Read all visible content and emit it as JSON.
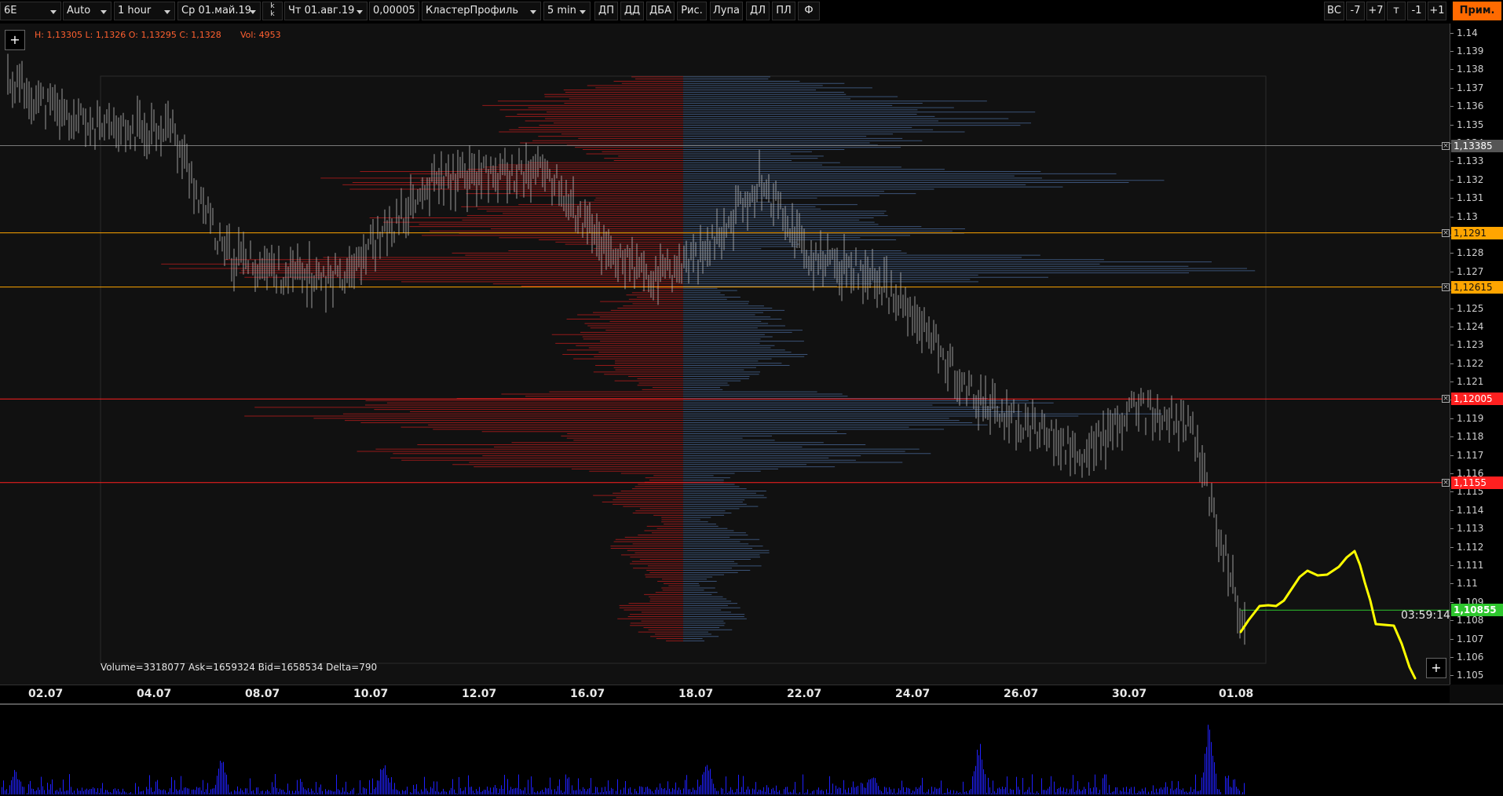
{
  "toolbar": {
    "symbol": "6E",
    "scale_mode": "Auto",
    "timeframe": "1 hour",
    "date_from": "Ср 01.май.19",
    "step_back_top": "k",
    "step_back_bottom": "k",
    "date_to": "Чт 01.авг.19",
    "tick_size": "0,00005",
    "chart_type": "КластерПрофиль",
    "cluster_timeframe": "5 min",
    "buttons": [
      "ДП",
      "ДД",
      "ДБА",
      "Рис.",
      "Лупа",
      "ДЛ",
      "ПЛ",
      "Ф"
    ],
    "right_buttons": [
      "ВС",
      "-7",
      "+7",
      "т",
      "-1",
      "+1"
    ],
    "apply_label": "Прим."
  },
  "info_bar": {
    "ohlc": "H: 1,13305 L: 1,1326 O: 1,13295 C: 1,1328",
    "volume": "Vol: 4953"
  },
  "plus_label": "+",
  "price_axis": {
    "ticks": [
      "1.14",
      "1.139",
      "1.138",
      "1.137",
      "1.136",
      "1.135",
      "1.134",
      "1.133",
      "1.132",
      "1.131",
      "1.13",
      "1.129",
      "1.128",
      "1.127",
      "1.126",
      "1.125",
      "1.124",
      "1.123",
      "1.122",
      "1.121",
      "1.12",
      "1.119",
      "1.118",
      "1.117",
      "1.116",
      "1.115",
      "1.114",
      "1.113",
      "1.112",
      "1.111",
      "1.11",
      "1.109",
      "1.108",
      "1.107",
      "1.106",
      "1.105"
    ],
    "levels": [
      {
        "label": "1,13385",
        "price": 1.13385,
        "style": "gray"
      },
      {
        "label": "1,1291",
        "price": 1.1291,
        "style": "orange"
      },
      {
        "label": "1,12615",
        "price": 1.12615,
        "style": "orange"
      },
      {
        "label": "1,12005",
        "price": 1.12005,
        "style": "red"
      },
      {
        "label": "1,1155",
        "price": 1.1155,
        "style": "red"
      },
      {
        "label": "1,10855",
        "price": 1.10855,
        "style": "green"
      }
    ]
  },
  "countdown": "03:59:14",
  "profile_stats": "Volume=3318077  Ask=1659324  Bid=1658534  Delta=790",
  "date_axis": [
    "02.07",
    "04.07",
    "08.07",
    "10.07",
    "12.07",
    "16.07",
    "18.07",
    "22.07",
    "24.07",
    "26.07",
    "30.07",
    "01.08"
  ],
  "colors": {
    "ask_profile": "#ff2020",
    "bid_profile": "#4a6a9a",
    "price_bars": "#bdbdbd",
    "volume_bars": "#2020ff",
    "forecast_line": "#ffff00",
    "level_orange": "#ffa500",
    "level_red": "#ff2020",
    "level_gray": "#7a7a7a",
    "level_green": "#2ec62e"
  },
  "chart_data": {
    "type": "line",
    "x": [
      "01.07",
      "02.07",
      "03.07",
      "04.07",
      "05.07",
      "08.07",
      "09.07",
      "10.07",
      "11.07",
      "12.07",
      "15.07",
      "16.07",
      "17.07",
      "18.07",
      "19.07",
      "22.07",
      "23.07",
      "24.07",
      "25.07",
      "26.07",
      "29.07",
      "30.07",
      "31.07",
      "01.08"
    ],
    "series": [
      {
        "values": [
          1.1375,
          1.1355,
          1.1345,
          1.135,
          1.128,
          1.127,
          1.1265,
          1.129,
          1.132,
          1.1322,
          1.1325,
          1.1285,
          1.1265,
          1.128,
          1.132,
          1.1275,
          1.127,
          1.124,
          1.12,
          1.1185,
          1.117,
          1.1195,
          1.1185,
          1.1075
        ]
      }
    ],
    "xlabel": "",
    "ylabel": "",
    "ylim": [
      1.1045,
      1.1405
    ],
    "grid": false,
    "volume_profile": {
      "ask_total": 1659324,
      "bid_total": 1658534,
      "delta": 790,
      "volume_total": 3318077
    }
  }
}
